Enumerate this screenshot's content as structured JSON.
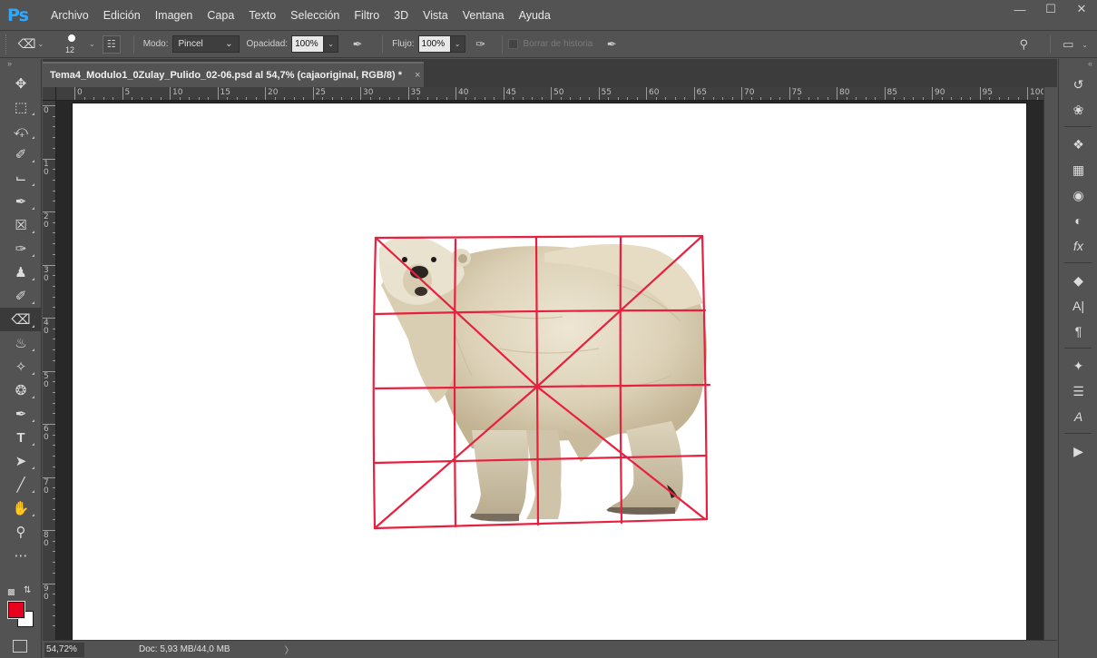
{
  "app": {
    "logo": "Ps",
    "menu": [
      "Archivo",
      "Edición",
      "Imagen",
      "Capa",
      "Texto",
      "Selección",
      "Filtro",
      "3D",
      "Vista",
      "Ventana",
      "Ayuda"
    ],
    "window_controls": [
      "minimize-icon",
      "maximize-icon",
      "close-icon"
    ]
  },
  "options": {
    "brush_size": "12",
    "mode_label": "Modo:",
    "mode_value": "Pincel",
    "opacity_label": "Opacidad:",
    "opacity_value": "100%",
    "flow_label": "Flujo:",
    "flow_value": "100%",
    "erase_history_label": "Borrar de historia"
  },
  "document": {
    "tab_title": "Tema4_Modulo1_0Zulay_Pulido_02-06.psd al 54,7% (cajaoriginal, RGB/8) *",
    "close_glyph": "×",
    "image_subject": "polar bear with red proportion grid overlay"
  },
  "rulers": {
    "top_labels": [
      "0",
      "5",
      "10",
      "15",
      "20",
      "25",
      "30",
      "35",
      "40",
      "45",
      "50",
      "55",
      "60",
      "65",
      "70",
      "75",
      "80",
      "85",
      "90",
      "95",
      "100"
    ],
    "left_labels": [
      "0",
      "1\n0",
      "2\n0",
      "3\n0",
      "4\n0",
      "5\n0",
      "6\n0",
      "7\n0",
      "8\n0",
      "9\n0"
    ]
  },
  "status": {
    "zoom": "54,72%",
    "doc_info": "Doc: 5,93 MB/44,0 MB",
    "arrow": "〉"
  },
  "colors": {
    "foreground": "#e8001f",
    "background": "#ffffff",
    "grid_lines": "#e8203f",
    "ui_bg": "#535353"
  },
  "toolbar": {
    "tools": [
      "move-tool",
      "marquee-tool",
      "lasso-tool",
      "quick-selection-tool",
      "crop-tool",
      "eyedropper-tool",
      "healing-brush-tool",
      "brush-tool",
      "clone-stamp-tool",
      "history-brush-tool",
      "eraser-tool",
      "paint-bucket-tool",
      "dodge-tool",
      "blur-tool",
      "pen-tool",
      "type-tool",
      "path-selection-tool",
      "line-tool",
      "hand-tool",
      "zoom-tool",
      "more-tools"
    ]
  },
  "right_dock": {
    "icons": [
      "history-icon",
      "color-wheel-icon",
      "3d-icon",
      "grid-icon",
      "swatches-icon",
      "adjustments-icon",
      "fx-icon",
      "layers-icon",
      "character-icon",
      "paragraph-icon",
      "brush-settings-icon",
      "properties-icon",
      "glyphs-icon",
      "play-icon"
    ]
  }
}
